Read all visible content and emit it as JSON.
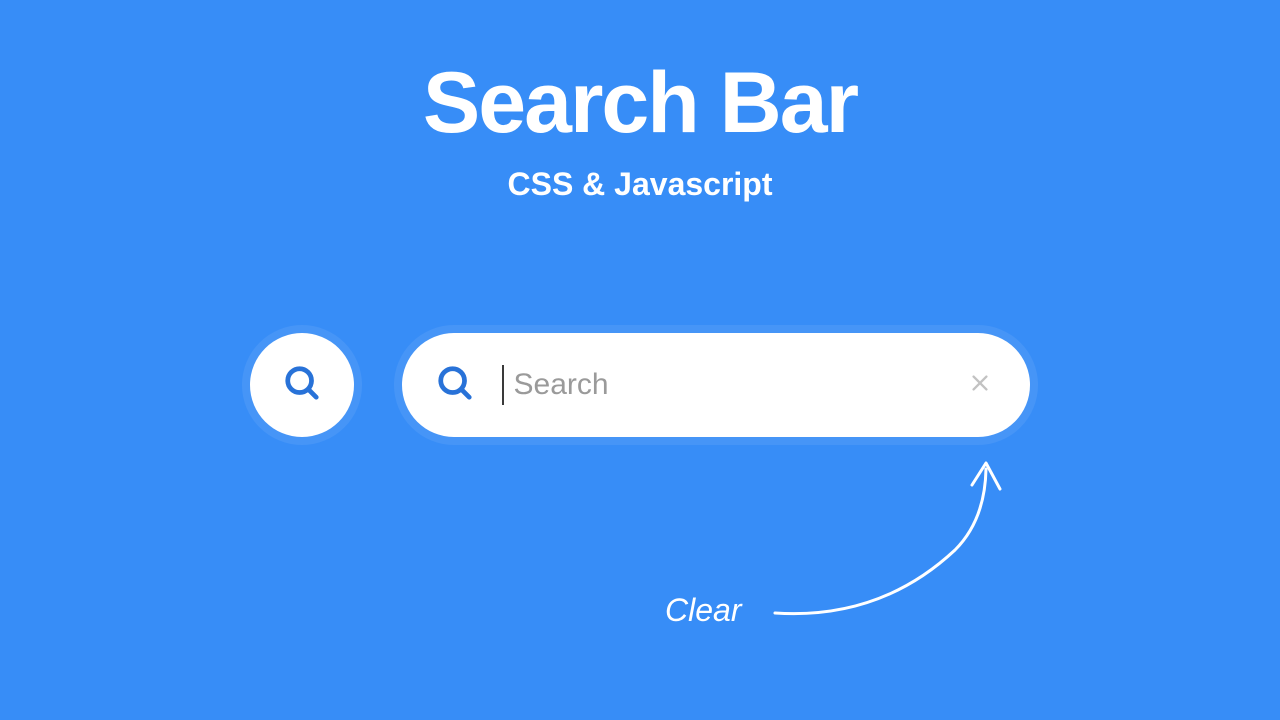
{
  "heading": {
    "title": "Search Bar",
    "subtitle": "CSS & Javascript"
  },
  "search": {
    "placeholder": "Search",
    "value": ""
  },
  "annotation": {
    "clear_label": "Clear"
  },
  "colors": {
    "background": "#378df7",
    "surface": "#ffffff",
    "icon_primary": "#2872d8",
    "icon_muted": "#c2c2c2",
    "text_placeholder": "#9a9a9a"
  }
}
